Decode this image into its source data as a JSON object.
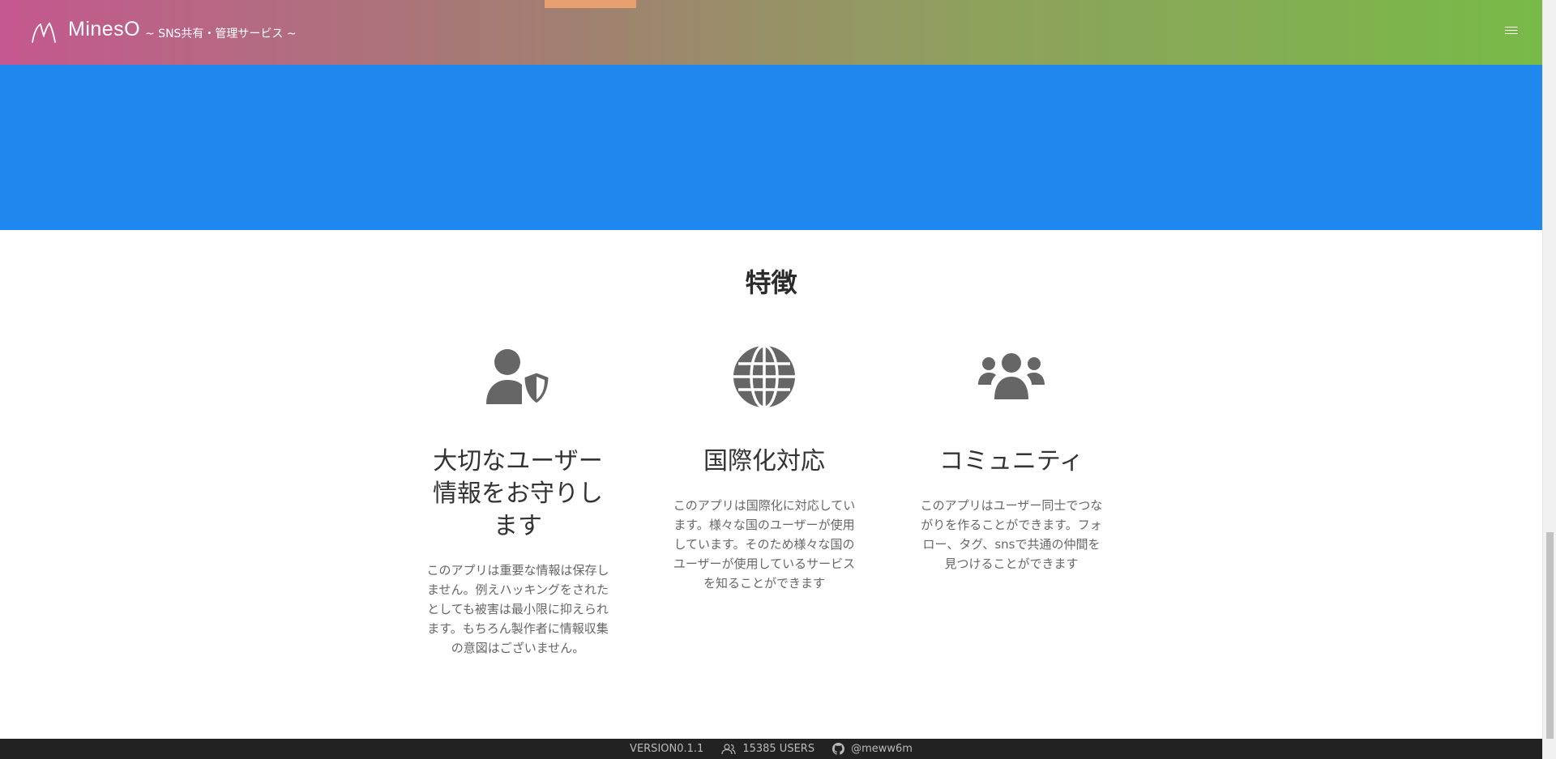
{
  "header": {
    "brand": "MinesO",
    "tagline": "~ SNS共有・管理サービス ~",
    "menu_icon": "hamburger-icon"
  },
  "carousel": {
    "slide_count": 3,
    "active_index": 0
  },
  "features": {
    "title": "特徴",
    "items": [
      {
        "icon": "user-shield-icon",
        "heading": "大切なユーザー情報をお守りします",
        "text": "このアプリは重要な情報は保存しません。例えハッキングをされたとしても被害は最小限に抑えられます。もちろん製作者に情報収集の意図はございません。"
      },
      {
        "icon": "globe-icon",
        "heading": "国際化対応",
        "text": "このアプリは国際化に対応しています。様々な国のユーザーが使用しています。そのため様々な国のユーザーが使用しているサービスを知ることができます"
      },
      {
        "icon": "users-icon",
        "heading": "コミュニティ",
        "text": "このアプリはユーザー同士でつながりを作ることができます。フォロー、タグ、snsで共通の仲間を見つけることができます"
      }
    ]
  },
  "footer": {
    "version": "VERSION0.1.1",
    "users": "15385 USERS",
    "github": "@meww6m"
  },
  "colors": {
    "hero_bg": "#1e88ee",
    "header_gradient_start": "#c4588f",
    "header_gradient_end": "#78ba48",
    "icon_gray": "#666666",
    "footer_bg": "#222222"
  }
}
